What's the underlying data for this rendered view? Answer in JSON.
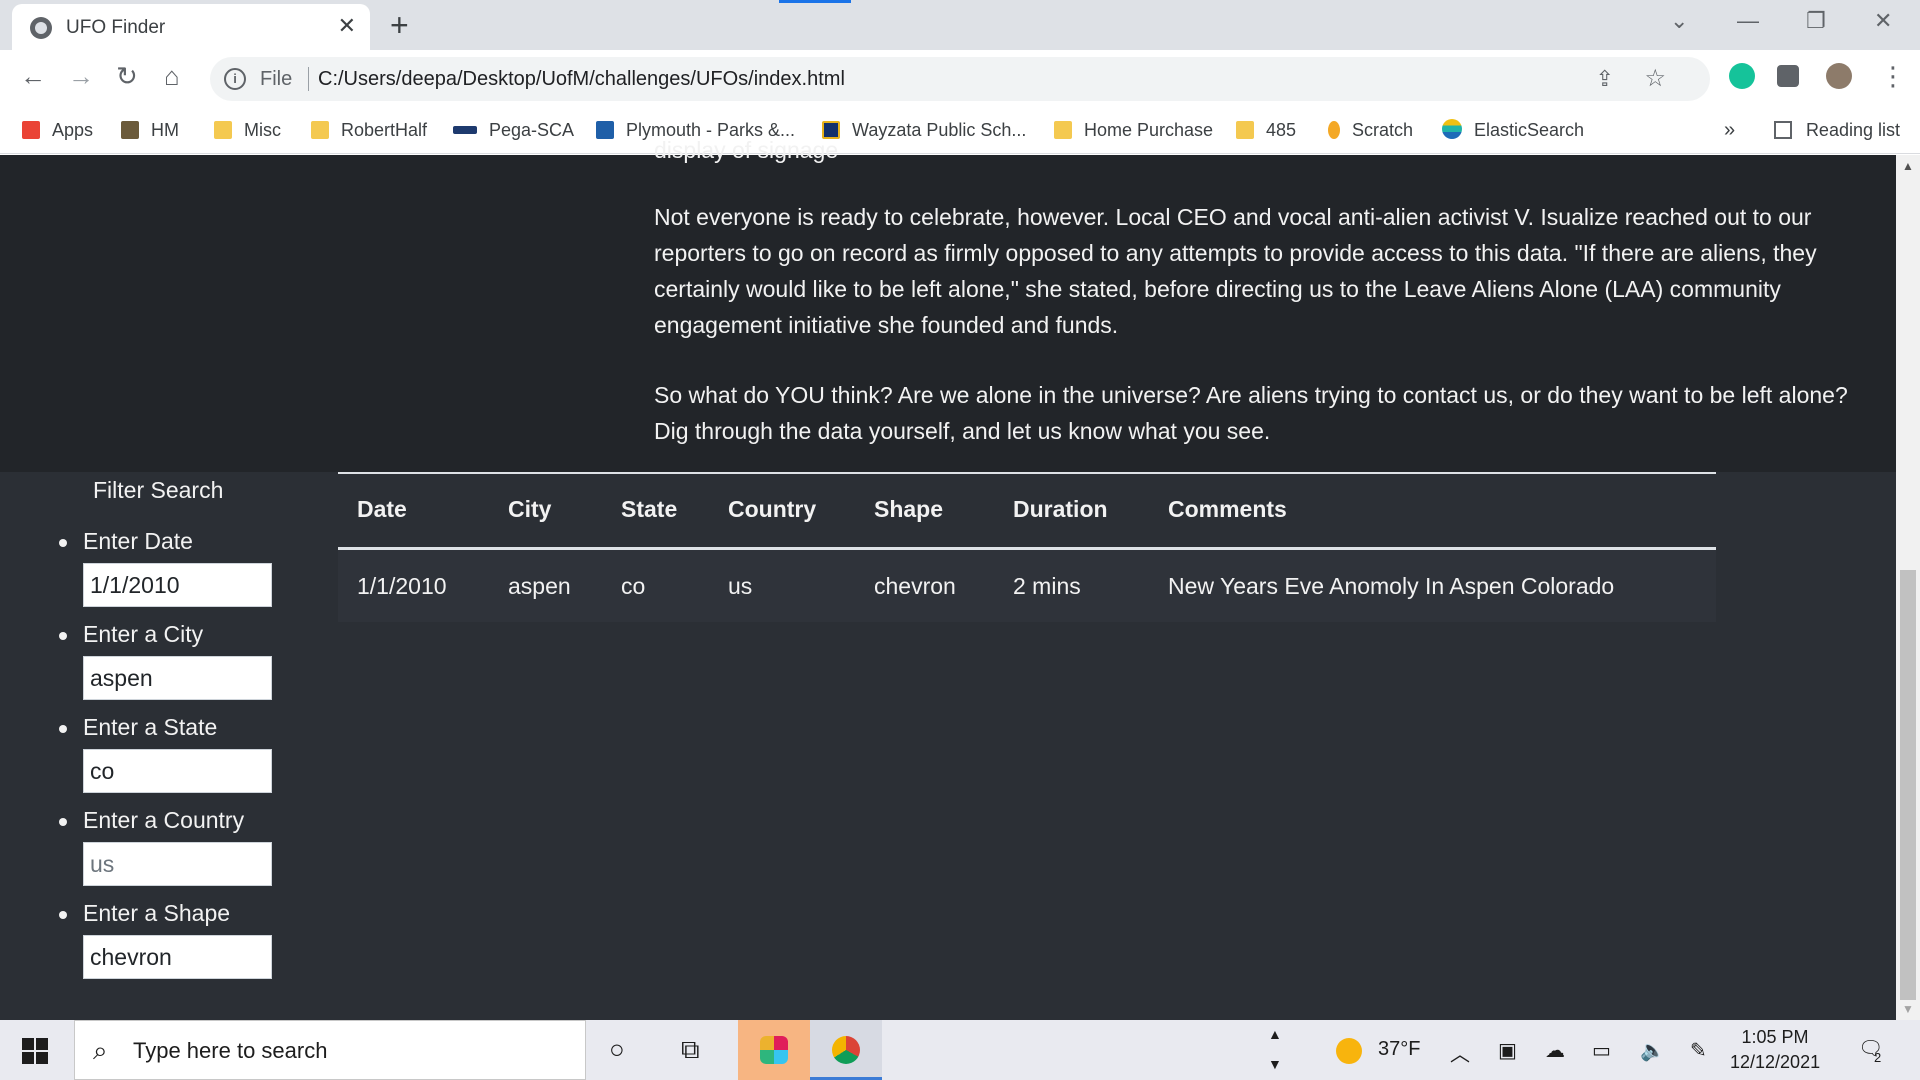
{
  "browser": {
    "tab_title": "UFO Finder",
    "tab_close": "✕",
    "new_tab": "+",
    "file_label": "File",
    "url": "C:/Users/deepa/Desktop/UofM/challenges/UFOs/index.html",
    "accent_color": "#1a73e8"
  },
  "bookmarks": [
    {
      "label": "Apps",
      "icon": "apps-grid-icon"
    },
    {
      "label": "HM",
      "icon": "hm-icon"
    },
    {
      "label": "Misc",
      "icon": "folder-icon"
    },
    {
      "label": "RobertHalf",
      "icon": "folder-icon"
    },
    {
      "label": "Pega-SCA",
      "icon": "pega-icon"
    },
    {
      "label": "Plymouth - Parks &...",
      "icon": "plymouth-icon"
    },
    {
      "label": "Wayzata Public Sch...",
      "icon": "wayzata-icon"
    },
    {
      "label": "Home Purchase",
      "icon": "folder-icon"
    },
    {
      "label": "485",
      "icon": "folder-icon"
    },
    {
      "label": "Scratch",
      "icon": "scratch-icon"
    },
    {
      "label": "ElasticSearch",
      "icon": "elastic-icon"
    }
  ],
  "bookmarks_more": "»",
  "reading_list": "Reading list",
  "article": {
    "clipped_line": "display of signage",
    "paragraph1": "Not everyone is ready to celebrate, however. Local CEO and vocal anti-alien activist V. Isualize reached out to our reporters to go on record as firmly opposed to any attempts to provide access to this data. \"If there are aliens, they certainly would like to be left alone,\" she stated, before directing us to the Leave Aliens Alone (LAA) community engagement initiative she founded and funds.",
    "paragraph2": "So what do YOU think? Are we alone in the universe? Are aliens trying to contact us, or do they want to be left alone? Dig through the data yourself, and let us know what you see."
  },
  "filters": {
    "title": "Filter Search",
    "items": [
      {
        "label": "Enter Date",
        "value": "1/1/2010"
      },
      {
        "label": "Enter a City",
        "value": "aspen"
      },
      {
        "label": "Enter a State",
        "value": "co"
      },
      {
        "label": "Enter a Country",
        "value": "us"
      },
      {
        "label": "Enter a Shape",
        "value": "chevron"
      }
    ]
  },
  "table": {
    "headers": [
      "Date",
      "City",
      "State",
      "Country",
      "Shape",
      "Duration",
      "Comments"
    ],
    "rows": [
      [
        "1/1/2010",
        "aspen",
        "co",
        "us",
        "chevron",
        "2 mins",
        "New Years Eve Anomoly In Aspen Colorado"
      ]
    ]
  },
  "taskbar": {
    "search_placeholder": "Type here to search",
    "weather": "37°F",
    "time": "1:05 PM",
    "date": "12/12/2021",
    "notifications": "2"
  }
}
